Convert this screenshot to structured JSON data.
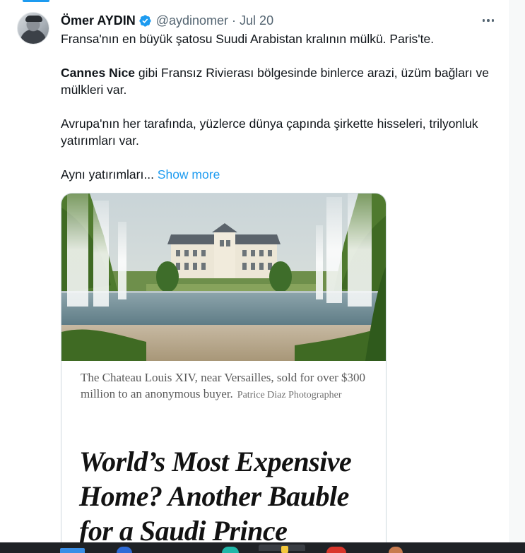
{
  "tweet": {
    "author_name": "Ömer AYDIN",
    "handle": "@aydinomer",
    "separator": "·",
    "date": "Jul 20",
    "line1": "Fransa'nın en büyük şatosu Suudi Arabistan kralının mülkü. Paris'te.",
    "para2_bold": "Cannes Nice",
    "para2_rest": " gibi Fransız Rivierası bölgesinde binlerce arazi, üzüm bağları ve mülkleri var.",
    "para3": "Avrupa'nın her tarafında, yüzlerce dünya çapında şirkette hisseleri, trilyonluk yatırımları var.",
    "para4": "Aynı yatırımları... ",
    "show_more": "Show more"
  },
  "card": {
    "caption": "The Chateau Louis XIV, near Versailles, sold for over $300 million to an anonymous buyer.",
    "credit": "Patrice Diaz Photographer",
    "headline": "World’s Most Expensive Home? Another Bauble for a Saudi Prince"
  },
  "icons": {
    "verified": "verified-badge-icon",
    "more": "more-options-icon"
  },
  "colors": {
    "accent": "#1d9bf0",
    "secondary_text": "#536471",
    "primary_text": "#0f1419"
  }
}
